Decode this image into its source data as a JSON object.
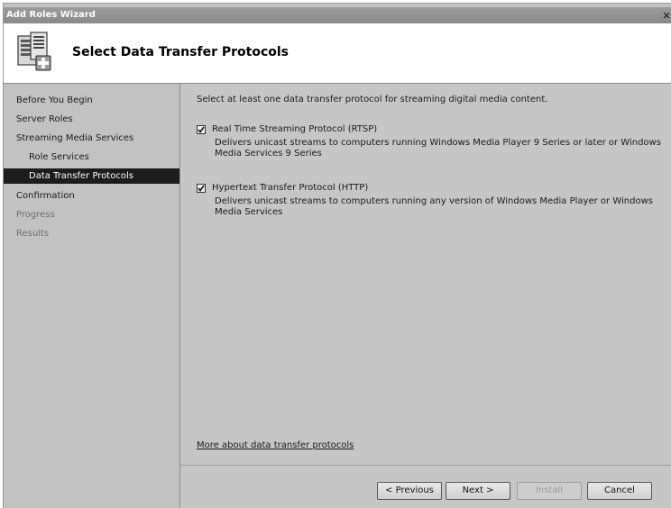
{
  "window": {
    "title": "Add Roles Wizard",
    "close_glyph": "×"
  },
  "header": {
    "title": "Select Data Transfer Protocols",
    "icon": "server-roles-add-icon"
  },
  "nav": {
    "items": [
      {
        "label": "Before You Begin",
        "state": "normal"
      },
      {
        "label": "Server Roles",
        "state": "normal"
      },
      {
        "label": "Streaming Media Services",
        "state": "normal"
      },
      {
        "label": "Role Services",
        "state": "normal"
      },
      {
        "label": "Data Transfer Protocols",
        "state": "selected"
      },
      {
        "label": "Confirmation",
        "state": "normal"
      },
      {
        "label": "Progress",
        "state": "disabled"
      },
      {
        "label": "Results",
        "state": "disabled"
      }
    ]
  },
  "content": {
    "intro": "Select at least one data transfer protocol for streaming digital media content.",
    "options": [
      {
        "label": "Real Time Streaming Protocol (RTSP)",
        "checked": true,
        "description": "Delivers unicast streams to computers running Windows Media Player 9 Series or later or Windows Media Services 9 Series"
      },
      {
        "label": "Hypertext Transfer Protocol (HTTP)",
        "checked": true,
        "description": "Delivers unicast streams to computers running any version of Windows Media Player or Windows Media Services"
      }
    ],
    "more_link": "More about data transfer protocols"
  },
  "buttons": {
    "previous": "< Previous",
    "next": "Next >",
    "install": "Install",
    "cancel": "Cancel"
  }
}
